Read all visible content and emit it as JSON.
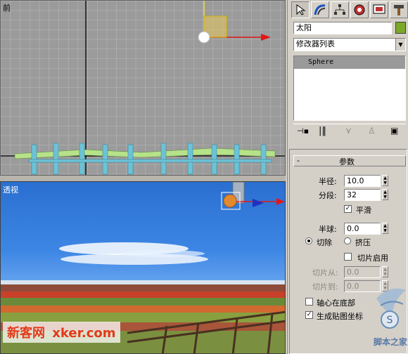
{
  "viewports": {
    "front_label": "前",
    "perspective_label": "透视"
  },
  "command_panel": {
    "tabs": [
      "create",
      "modify",
      "hierarchy",
      "motion",
      "display",
      "utilities"
    ],
    "object_name": "太阳",
    "object_color": "#7ca82a",
    "modifier_list_label": "修改器列表",
    "modifier_stack": [
      "Sphere"
    ],
    "rollout_toggle": "-",
    "rollout_title": "参数",
    "params": {
      "radius_label": "半径:",
      "radius_value": "10.0",
      "segments_label": "分段:",
      "segments_value": "32",
      "smooth_label": "平滑",
      "smooth_checked": true,
      "hemisphere_label": "半球:",
      "hemisphere_value": "0.0",
      "chop_label": "切除",
      "squash_label": "挤压",
      "selected_mode": "chop",
      "slice_on_label": "切片启用",
      "slice_from_label": "切片从:",
      "slice_from_value": "0.0",
      "slice_to_label": "切片到:",
      "slice_to_value": "0.0",
      "base_to_pivot_label": "轴心在底部",
      "gen_mapping_label": "生成贴图坐标"
    }
  },
  "watermark": {
    "text": "新客网",
    "url": "xker.com",
    "logo_text": "脚本之家"
  }
}
